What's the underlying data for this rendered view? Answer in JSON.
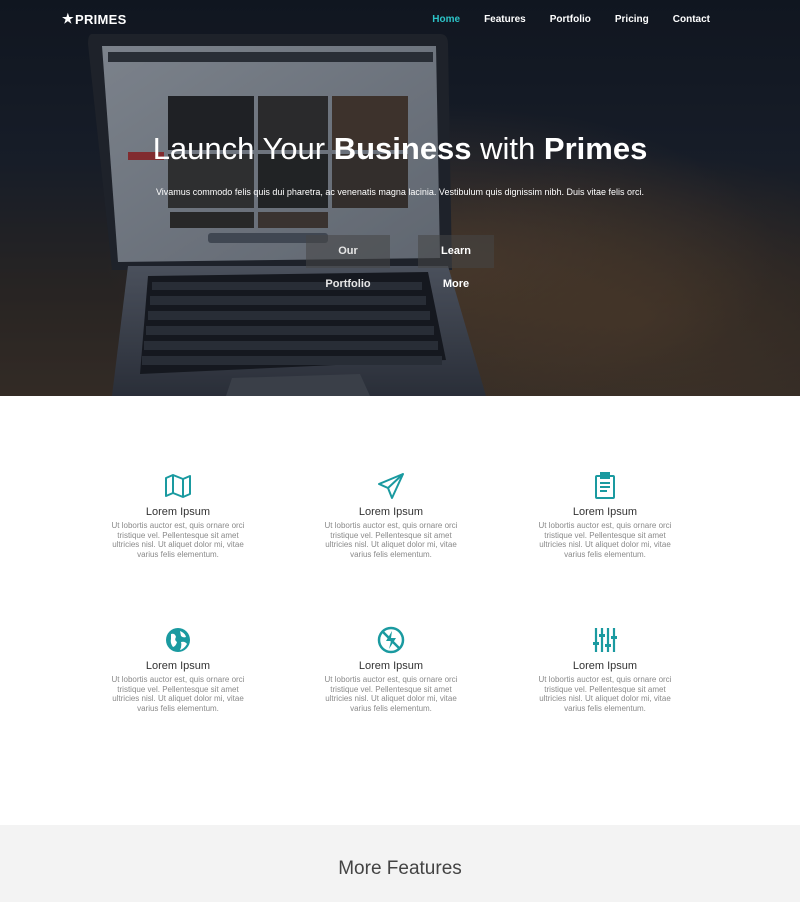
{
  "brand": {
    "name": "PRIMES",
    "icon": "star-icon"
  },
  "nav": {
    "items": [
      {
        "label": "Home",
        "active": true
      },
      {
        "label": "Features",
        "active": false
      },
      {
        "label": "Portfolio",
        "active": false
      },
      {
        "label": "Pricing",
        "active": false
      },
      {
        "label": "Contact",
        "active": false
      }
    ]
  },
  "hero": {
    "title_part1": "Launch Your ",
    "title_bold1": "Business",
    "title_part2": " with ",
    "title_bold2": "Primes",
    "subtitle": "Vivamus commodo felis quis dui pharetra, ac venenatis magna lacinia. Vestibulum quis dignissim nibh. Duis vitae felis orci.",
    "buttons": {
      "portfolio": "Our Portfolio",
      "learn_more": "Learn More"
    }
  },
  "features": [
    {
      "icon": "map-icon",
      "title": "Lorem Ipsum",
      "text": "Ut lobortis auctor est, quis ornare orci tristique vel. Pellentesque sit amet ultricies nisl. Ut aliquet dolor mi, vitae varius felis elementum."
    },
    {
      "icon": "paper-plane-icon",
      "title": "Lorem Ipsum",
      "text": "Ut lobortis auctor est, quis ornare orci tristique vel. Pellentesque sit amet ultricies nisl. Ut aliquet dolor mi, vitae varius felis elementum."
    },
    {
      "icon": "clipboard-icon",
      "title": "Lorem Ipsum",
      "text": "Ut lobortis auctor est, quis ornare orci tristique vel. Pellentesque sit amet ultricies nisl. Ut aliquet dolor mi, vitae varius felis elementum."
    },
    {
      "icon": "globe-icon",
      "title": "Lorem Ipsum",
      "text": "Ut lobortis auctor est, quis ornare orci tristique vel. Pellentesque sit amet ultricies nisl. Ut aliquet dolor mi, vitae varius felis elementum."
    },
    {
      "icon": "no-lightning-icon",
      "title": "Lorem Ipsum",
      "text": "Ut lobortis auctor est, quis ornare orci tristique vel. Pellentesque sit amet ultricies nisl. Ut aliquet dolor mi, vitae varius felis elementum."
    },
    {
      "icon": "equalizer-icon",
      "title": "Lorem Ipsum",
      "text": "Ut lobortis auctor est, quis ornare orci tristique vel. Pellentesque sit amet ultricies nisl. Ut aliquet dolor mi, vitae varius felis elementum."
    }
  ],
  "more_features": {
    "title": "More Features"
  },
  "colors": {
    "accent": "#2cc3c7",
    "icon": "#1a9aa0"
  }
}
